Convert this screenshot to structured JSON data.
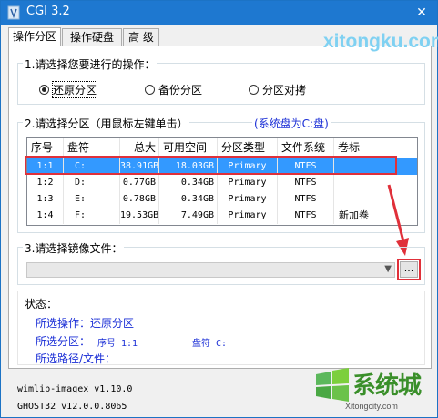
{
  "window": {
    "title": "CGI 3.2"
  },
  "tabs": [
    {
      "label": "操作分区",
      "active": true
    },
    {
      "label": "操作硬盘",
      "active": false
    },
    {
      "label": "高 级",
      "active": false
    }
  ],
  "section1": {
    "title": "1.请选择您要进行的操作：",
    "options": [
      {
        "label": "还原分区",
        "selected": true
      },
      {
        "label": "备份分区",
        "selected": false
      },
      {
        "label": "分区对拷",
        "selected": false
      }
    ]
  },
  "section2": {
    "title": "2.请选择分区（用鼠标左键单击）",
    "system_disk": "(系统盘为C:盘)",
    "columns": [
      "序号",
      "盘符",
      "总大小",
      "可用空间",
      "分区类型",
      "文件系统",
      "卷标"
    ],
    "rows": [
      {
        "index": "1:1",
        "drive": "C:",
        "total": "38.91GB",
        "free": "18.03GB",
        "type": "Primary",
        "fs": "NTFS",
        "label": "",
        "selected": true
      },
      {
        "index": "1:2",
        "drive": "D:",
        "total": "0.77GB",
        "free": "0.34GB",
        "type": "Primary",
        "fs": "NTFS",
        "label": "",
        "selected": false
      },
      {
        "index": "1:3",
        "drive": "E:",
        "total": "0.78GB",
        "free": "0.34GB",
        "type": "Primary",
        "fs": "NTFS",
        "label": "",
        "selected": false
      },
      {
        "index": "1:4",
        "drive": "F:",
        "total": "19.53GB",
        "free": "7.49GB",
        "type": "Primary",
        "fs": "NTFS",
        "label": "新加卷",
        "selected": false
      }
    ]
  },
  "section3": {
    "title": "3.请选择镜像文件：",
    "image_value": "",
    "browse_label": "..."
  },
  "status": {
    "title": "状态：",
    "operation": "所选操作：还原分区",
    "partition_label": "所选分区：",
    "partition_index": "序号 1:1",
    "partition_drive": "盘符 C:",
    "path_label": "所选路径/文件："
  },
  "footer": {
    "wimlib": "wimlib-imagex v1.10.0",
    "ghost": "GHOST32 v12.0.0.8065"
  },
  "watermark": {
    "site_top": "xitongku.com",
    "logo_text": "系统城",
    "logo_url": "Xitongcity.com"
  },
  "colors": {
    "titlebar": "#1e78d0",
    "selection": "#3399ff",
    "highlight_red": "#e0303a",
    "status_blue": "#1a2ed6"
  }
}
